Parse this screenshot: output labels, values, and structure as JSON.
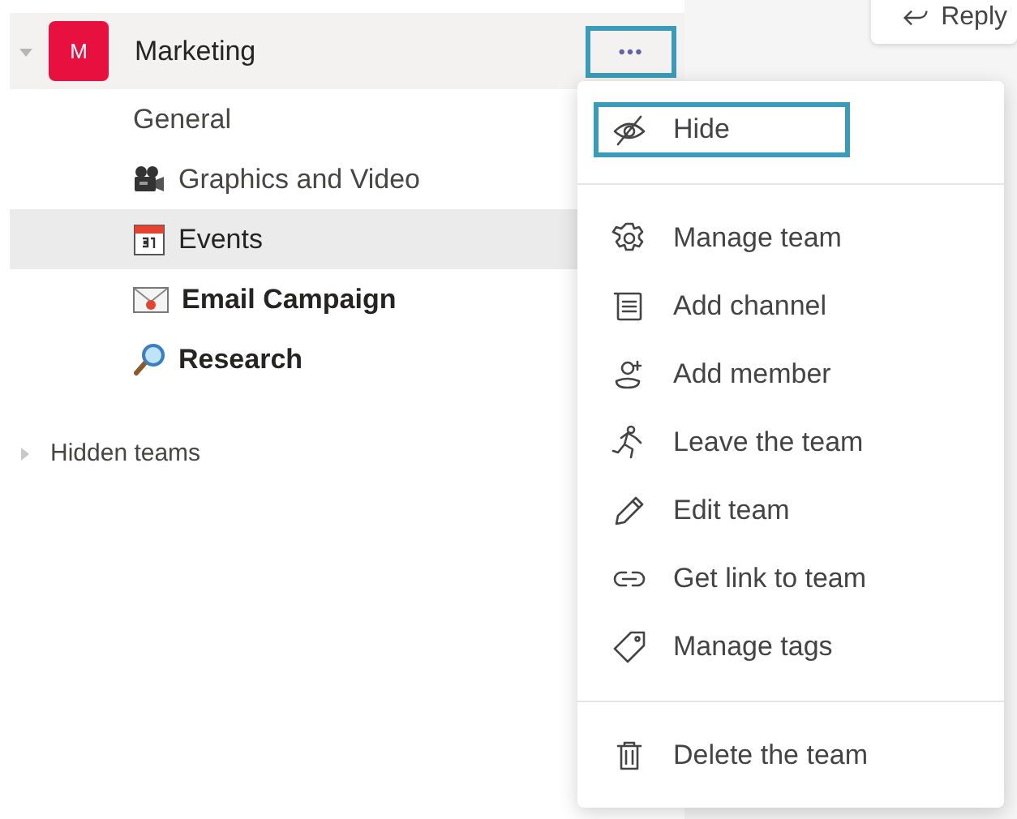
{
  "team": {
    "avatar": "M",
    "name": "Marketing",
    "expanded": true,
    "more_button": {
      "label": "•••",
      "highlighted": true
    }
  },
  "channels": [
    {
      "name": "General",
      "selected": false,
      "unread": false
    },
    {
      "name": "Graphics and Video",
      "selected": false,
      "unread": false
    },
    {
      "name": "Events",
      "selected": true,
      "unread": false
    },
    {
      "name": "Email Campaign",
      "selected": false,
      "unread": true
    },
    {
      "name": "Research",
      "selected": false,
      "unread": true
    }
  ],
  "hidden_teams": {
    "label": "Hidden teams",
    "expanded": false
  },
  "reply_button": {
    "label": "Reply"
  },
  "menu": {
    "groups": [
      [
        {
          "label": "Hide",
          "highlighted": true
        }
      ],
      [
        {
          "label": "Manage team",
          "highlighted": false
        },
        {
          "label": "Add channel",
          "highlighted": false
        },
        {
          "label": "Add member",
          "highlighted": false
        },
        {
          "label": "Leave the team",
          "highlighted": false
        },
        {
          "label": "Edit team",
          "highlighted": false
        },
        {
          "label": "Get link to team",
          "highlighted": false
        },
        {
          "label": "Manage tags",
          "highlighted": false
        }
      ],
      [
        {
          "label": "Delete the team",
          "highlighted": false
        }
      ]
    ]
  }
}
